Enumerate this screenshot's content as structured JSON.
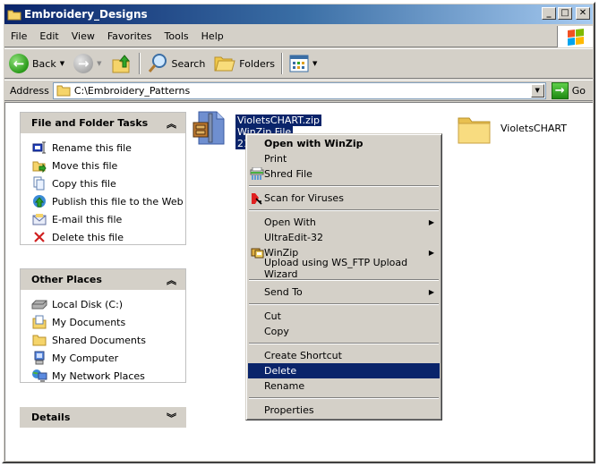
{
  "window": {
    "title": "Embroidery_Designs",
    "controls": {
      "minimize": "_",
      "maximize": "□",
      "close": "✕"
    }
  },
  "menubar": {
    "items": [
      "File",
      "Edit",
      "View",
      "Favorites",
      "Tools",
      "Help"
    ]
  },
  "toolbar": {
    "back_label": "Back",
    "search_label": "Search",
    "folders_label": "Folders"
  },
  "address": {
    "label": "Address",
    "value": "C:\\Embroidery_Patterns",
    "go_label": "Go"
  },
  "tasks_panel": {
    "title": "File and Folder Tasks",
    "collapse_glyph": "︽",
    "items": [
      {
        "label": "Rename this file",
        "icon": "rename-icon"
      },
      {
        "label": "Move this file",
        "icon": "move-icon"
      },
      {
        "label": "Copy this file",
        "icon": "copy-icon"
      },
      {
        "label": "Publish this file to the Web",
        "icon": "publish-web-icon"
      },
      {
        "label": "E-mail this file",
        "icon": "email-icon"
      },
      {
        "label": "Delete this file",
        "icon": "delete-icon"
      }
    ]
  },
  "places_panel": {
    "title": "Other Places",
    "collapse_glyph": "︽",
    "items": [
      {
        "label": "Local Disk (C:)",
        "icon": "local-disk-icon"
      },
      {
        "label": "My Documents",
        "icon": "my-documents-icon"
      },
      {
        "label": "Shared Documents",
        "icon": "shared-documents-icon"
      },
      {
        "label": "My Computer",
        "icon": "my-computer-icon"
      },
      {
        "label": "My Network Places",
        "icon": "network-places-icon"
      }
    ]
  },
  "details_panel": {
    "title": "Details",
    "expand_glyph": "︾"
  },
  "files": [
    {
      "name": "VioletsCHART.zip",
      "type": "WinZip File",
      "size_partial": "21",
      "selected": true,
      "icon": "zip-file-icon"
    },
    {
      "name": "VioletsCHART",
      "selected": false,
      "icon": "folder-icon"
    }
  ],
  "context_menu": {
    "groups": [
      [
        {
          "label": "Open with WinZip",
          "bold": true
        },
        {
          "label": "Print"
        },
        {
          "label": "Shred File",
          "icon": "shredder-icon"
        }
      ],
      [
        {
          "label": "Scan for Viruses",
          "icon": "antivirus-icon"
        }
      ],
      [
        {
          "label": "Open With",
          "submenu": true
        },
        {
          "label": "UltraEdit-32"
        },
        {
          "label": "WinZip",
          "icon": "winzip-icon",
          "submenu": true
        },
        {
          "label": "Upload using WS_FTP Upload Wizard"
        }
      ],
      [
        {
          "label": "Send To",
          "submenu": true
        }
      ],
      [
        {
          "label": "Cut"
        },
        {
          "label": "Copy"
        }
      ],
      [
        {
          "label": "Create Shortcut"
        },
        {
          "label": "Delete",
          "highlighted": true
        },
        {
          "label": "Rename"
        }
      ],
      [
        {
          "label": "Properties"
        }
      ]
    ],
    "submenu_glyph": "▶"
  },
  "colors": {
    "selection": "#0a246a",
    "face": "#d4d0c8",
    "title_start": "#0a246a",
    "title_end": "#a6caf0"
  }
}
